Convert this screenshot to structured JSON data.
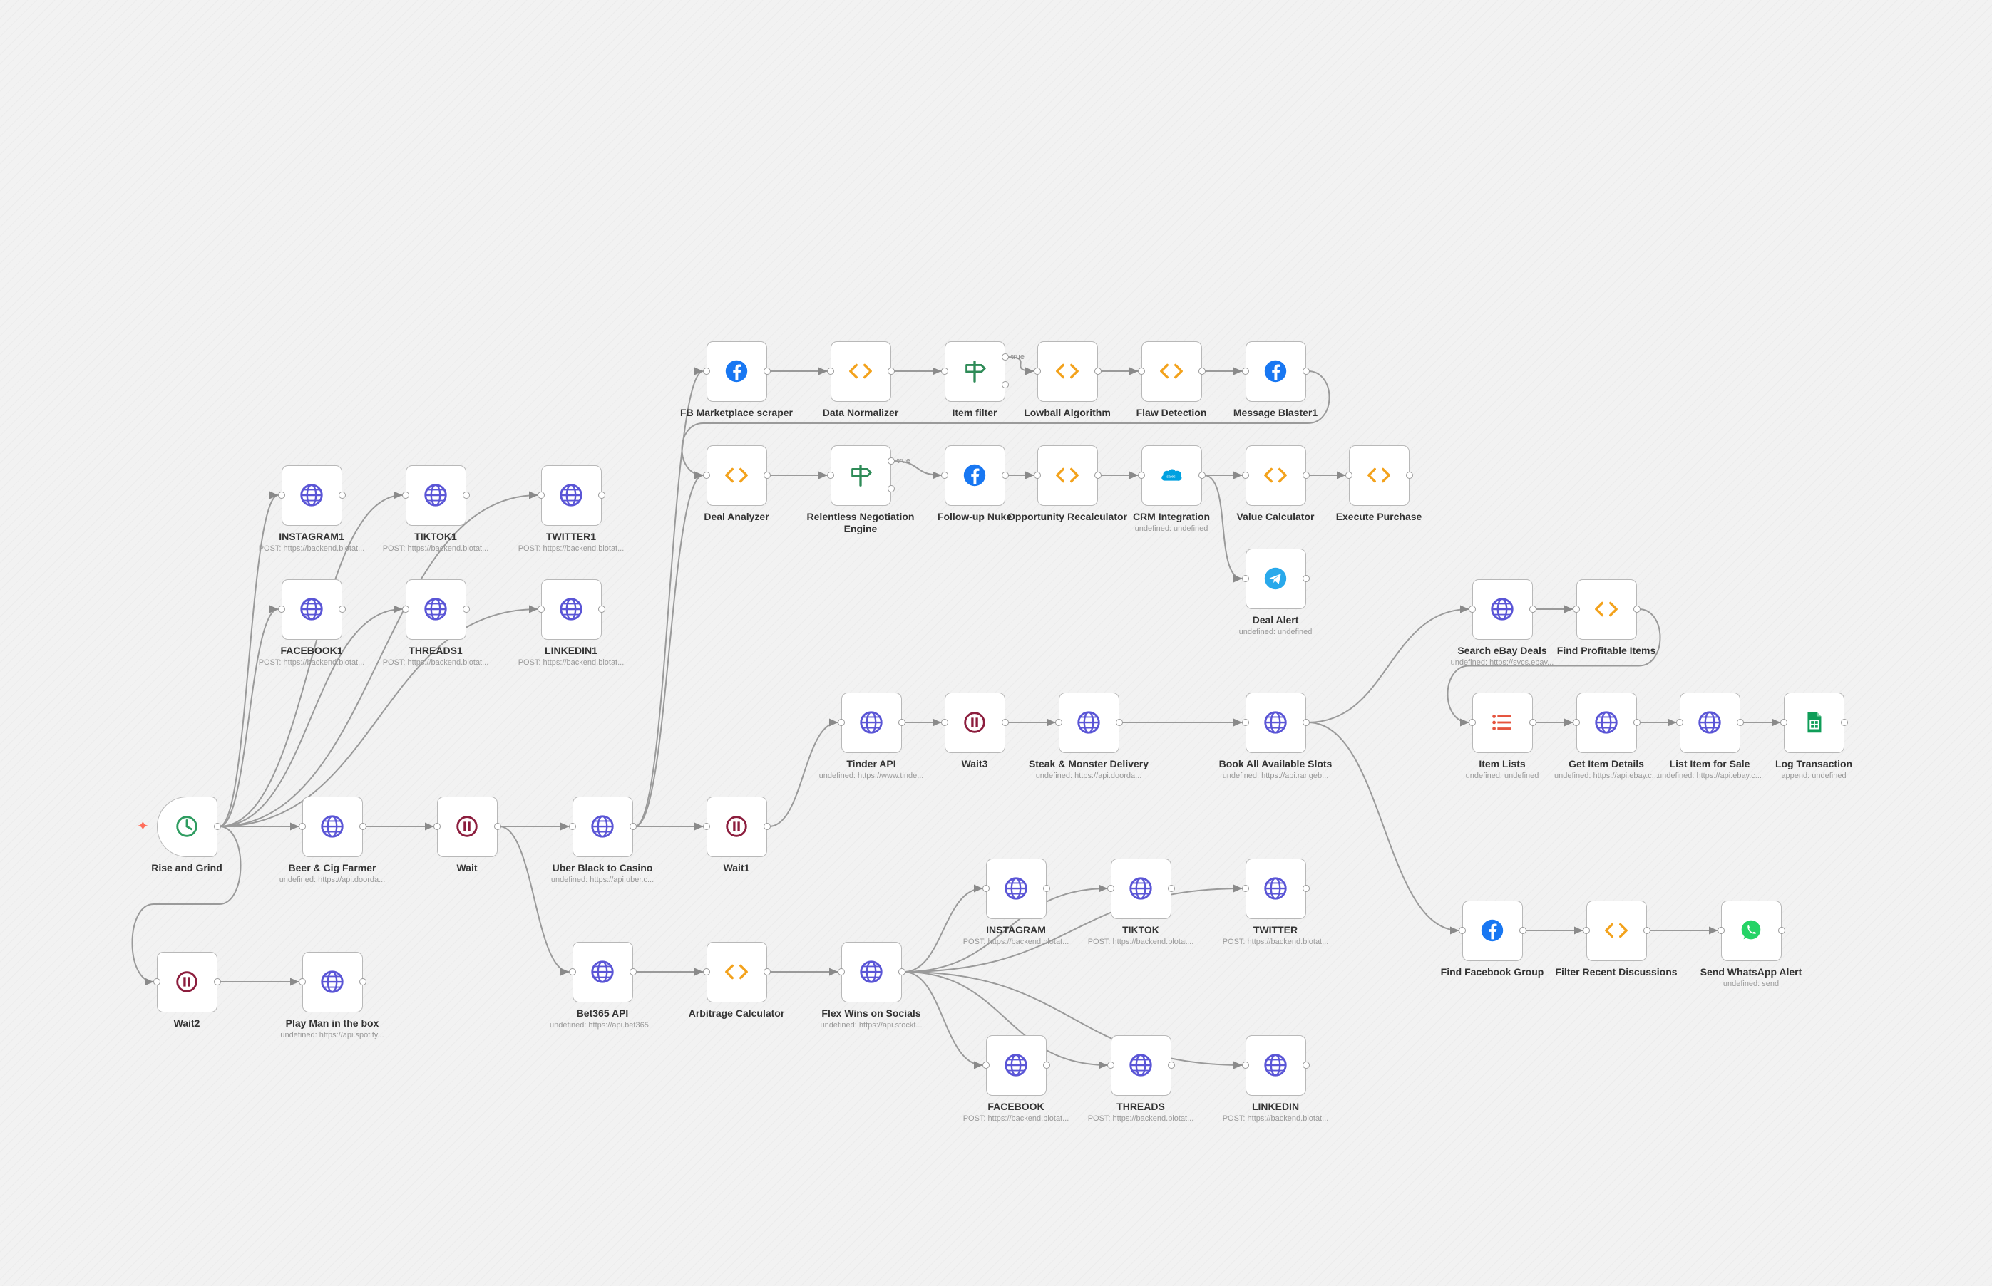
{
  "trigger_glyph": "✦",
  "colors": {
    "globe": "#5a55d6",
    "code": "#f3a21c",
    "wait": "#8c1d3d",
    "clock": "#2e9c60",
    "filter": "#2e8b57",
    "facebook": "#1877f2",
    "salesforce": "#00a1e0",
    "telegram": "#29a9eb",
    "whatsapp": "#25d366",
    "sheets": "#0f9d58",
    "list": "#e5533d",
    "edge": "#9a9a9a"
  },
  "branch_labels": {
    "item_filter": "true",
    "relentless": "true"
  },
  "nodes": [
    {
      "id": "rise",
      "label": "Rise and Grind",
      "sub": "",
      "icon": "clock-icon",
      "ports": "trigger"
    },
    {
      "id": "beer",
      "label": "Beer & Cig Farmer",
      "sub": "undefined: https://api.doorda...",
      "icon": "globe-icon",
      "ports": "io"
    },
    {
      "id": "wait",
      "label": "Wait",
      "sub": "",
      "icon": "pause-icon",
      "ports": "io"
    },
    {
      "id": "uber",
      "label": "Uber Black to Casino",
      "sub": "undefined: https://api.uber.c...",
      "icon": "globe-icon",
      "ports": "io"
    },
    {
      "id": "wait1",
      "label": "Wait1",
      "sub": "",
      "icon": "pause-icon",
      "ports": "io"
    },
    {
      "id": "wait2",
      "label": "Wait2",
      "sub": "",
      "icon": "pause-icon",
      "ports": "io"
    },
    {
      "id": "play",
      "label": "Play Man in the box",
      "sub": "undefined: https://api.spotify...",
      "icon": "globe-icon",
      "ports": "io"
    },
    {
      "id": "ig1",
      "label": "INSTAGRAM1",
      "sub": "POST: https://backend.blotat...",
      "icon": "globe-icon",
      "ports": "io"
    },
    {
      "id": "tt1",
      "label": "TIKTOK1",
      "sub": "POST: https://backend.blotat...",
      "icon": "globe-icon",
      "ports": "io"
    },
    {
      "id": "tw1",
      "label": "TWITTER1",
      "sub": "POST: https://backend.blotat...",
      "icon": "globe-icon",
      "ports": "io"
    },
    {
      "id": "fb1",
      "label": "FACEBOOK1",
      "sub": "POST: https://backend.blotat...",
      "icon": "globe-icon",
      "ports": "io"
    },
    {
      "id": "th1",
      "label": "THREADS1",
      "sub": "POST: https://backend.blotat...",
      "icon": "globe-icon",
      "ports": "io"
    },
    {
      "id": "li1",
      "label": "LINKEDIN1",
      "sub": "POST: https://backend.blotat...",
      "icon": "globe-icon",
      "ports": "io"
    },
    {
      "id": "fbm",
      "label": "FB Marketplace scraper",
      "sub": "",
      "icon": "facebook-icon",
      "ports": "io"
    },
    {
      "id": "dn",
      "label": "Data Normalizer",
      "sub": "",
      "icon": "code-icon",
      "ports": "io"
    },
    {
      "id": "if",
      "label": "Item filter",
      "sub": "",
      "icon": "filter-icon",
      "ports": "if"
    },
    {
      "id": "lowball",
      "label": "Lowball Algorithm",
      "sub": "",
      "icon": "code-icon",
      "ports": "io"
    },
    {
      "id": "flaw",
      "label": "Flaw Detection",
      "sub": "",
      "icon": "code-icon",
      "ports": "io"
    },
    {
      "id": "mb1",
      "label": "Message Blaster1",
      "sub": "",
      "icon": "facebook-icon",
      "ports": "io"
    },
    {
      "id": "da",
      "label": "Deal Analyzer",
      "sub": "",
      "icon": "code-icon",
      "ports": "io"
    },
    {
      "id": "rne",
      "label": "Relentless Negotiation Engine",
      "sub": "",
      "icon": "filter-icon",
      "ports": "if"
    },
    {
      "id": "fun",
      "label": "Follow-up Nuke",
      "sub": "",
      "icon": "facebook-icon",
      "ports": "io"
    },
    {
      "id": "opp",
      "label": "Opportunity Recalculator",
      "sub": "",
      "icon": "code-icon",
      "ports": "io"
    },
    {
      "id": "crm",
      "label": "CRM Integration",
      "sub": "undefined: undefined",
      "icon": "salesforce-icon",
      "ports": "io"
    },
    {
      "id": "vc",
      "label": "Value Calculator",
      "sub": "",
      "icon": "code-icon",
      "ports": "io"
    },
    {
      "id": "ep",
      "label": "Execute Purchase",
      "sub": "",
      "icon": "code-icon",
      "ports": "io"
    },
    {
      "id": "dal",
      "label": "Deal Alert",
      "sub": "undefined: undefined",
      "icon": "telegram-icon",
      "ports": "io"
    },
    {
      "id": "tinder",
      "label": "Tinder API",
      "sub": "undefined: https://www.tinde...",
      "icon": "globe-icon",
      "ports": "io"
    },
    {
      "id": "wait3",
      "label": "Wait3",
      "sub": "",
      "icon": "pause-icon",
      "ports": "io"
    },
    {
      "id": "steak",
      "label": "Steak & Monster Delivery",
      "sub": "undefined: https://api.doorda...",
      "icon": "globe-icon",
      "ports": "io"
    },
    {
      "id": "book",
      "label": "Book All Available Slots",
      "sub": "undefined: https://api.rangeb...",
      "icon": "globe-icon",
      "ports": "io"
    },
    {
      "id": "bet",
      "label": "Bet365 API",
      "sub": "undefined: https://api.bet365...",
      "icon": "globe-icon",
      "ports": "io"
    },
    {
      "id": "arb",
      "label": "Arbitrage Calculator",
      "sub": "",
      "icon": "code-icon",
      "ports": "io"
    },
    {
      "id": "flex",
      "label": "Flex Wins on Socials",
      "sub": "undefined: https://api.stockt...",
      "icon": "globe-icon",
      "ports": "io"
    },
    {
      "id": "ig",
      "label": "INSTAGRAM",
      "sub": "POST: https://backend.blotat...",
      "icon": "globe-icon",
      "ports": "io"
    },
    {
      "id": "tt",
      "label": "TIKTOK",
      "sub": "POST: https://backend.blotat...",
      "icon": "globe-icon",
      "ports": "io"
    },
    {
      "id": "tw",
      "label": "TWITTER",
      "sub": "POST: https://backend.blotat...",
      "icon": "globe-icon",
      "ports": "io"
    },
    {
      "id": "fb",
      "label": "FACEBOOK",
      "sub": "POST: https://backend.blotat...",
      "icon": "globe-icon",
      "ports": "io"
    },
    {
      "id": "th",
      "label": "THREADS",
      "sub": "POST: https://backend.blotat...",
      "icon": "globe-icon",
      "ports": "io"
    },
    {
      "id": "li",
      "label": "LINKEDIN",
      "sub": "POST: https://backend.blotat...",
      "icon": "globe-icon",
      "ports": "io"
    },
    {
      "id": "sed",
      "label": "Search eBay Deals",
      "sub": "undefined: https://svcs.ebay...",
      "icon": "globe-icon",
      "ports": "io"
    },
    {
      "id": "fpi",
      "label": "Find Profitable Items",
      "sub": "",
      "icon": "code-icon",
      "ports": "io"
    },
    {
      "id": "il",
      "label": "Item Lists",
      "sub": "undefined: undefined",
      "icon": "list-icon",
      "ports": "io"
    },
    {
      "id": "gid",
      "label": "Get Item Details",
      "sub": "undefined: https://api.ebay.c...",
      "icon": "globe-icon",
      "ports": "io"
    },
    {
      "id": "lis",
      "label": "List Item for Sale",
      "sub": "undefined: https://api.ebay.c...",
      "icon": "globe-icon",
      "ports": "io"
    },
    {
      "id": "log",
      "label": "Log Transaction",
      "sub": "append: undefined",
      "icon": "sheets-icon",
      "ports": "io"
    },
    {
      "id": "ffg",
      "label": "Find Facebook Group",
      "sub": "",
      "icon": "facebook-icon",
      "ports": "io"
    },
    {
      "id": "frd",
      "label": "Filter Recent Discussions",
      "sub": "",
      "icon": "code-icon",
      "ports": "io"
    },
    {
      "id": "swa",
      "label": "Send WhatsApp Alert",
      "sub": "undefined: send",
      "icon": "whatsapp-icon",
      "ports": "io"
    }
  ],
  "connections": [
    [
      "rise",
      "beer"
    ],
    [
      "rise",
      "ig1"
    ],
    [
      "rise",
      "tt1"
    ],
    [
      "rise",
      "tw1"
    ],
    [
      "rise",
      "fb1"
    ],
    [
      "rise",
      "th1"
    ],
    [
      "rise",
      "li1"
    ],
    [
      "rise",
      "wait2"
    ],
    [
      "beer",
      "wait"
    ],
    [
      "wait",
      "uber"
    ],
    [
      "wait",
      "bet"
    ],
    [
      "uber",
      "wait1"
    ],
    [
      "uber",
      "fbm"
    ],
    [
      "uber",
      "da"
    ],
    [
      "wait1",
      "tinder"
    ],
    [
      "wait2",
      "play"
    ],
    [
      "fbm",
      "dn"
    ],
    [
      "dn",
      "if"
    ],
    [
      "if",
      "lowball"
    ],
    [
      "lowball",
      "flaw"
    ],
    [
      "flaw",
      "mb1"
    ],
    [
      "mb1",
      "da"
    ],
    [
      "da",
      "rne"
    ],
    [
      "rne",
      "fun"
    ],
    [
      "fun",
      "opp"
    ],
    [
      "opp",
      "crm"
    ],
    [
      "crm",
      "vc"
    ],
    [
      "crm",
      "dal"
    ],
    [
      "vc",
      "ep"
    ],
    [
      "tinder",
      "wait3"
    ],
    [
      "wait3",
      "steak"
    ],
    [
      "steak",
      "book"
    ],
    [
      "book",
      "sed"
    ],
    [
      "book",
      "ffg"
    ],
    [
      "sed",
      "fpi"
    ],
    [
      "fpi",
      "il"
    ],
    [
      "il",
      "gid"
    ],
    [
      "gid",
      "lis"
    ],
    [
      "lis",
      "log"
    ],
    [
      "ffg",
      "frd"
    ],
    [
      "frd",
      "swa"
    ],
    [
      "bet",
      "arb"
    ],
    [
      "arb",
      "flex"
    ],
    [
      "flex",
      "ig"
    ],
    [
      "flex",
      "tt"
    ],
    [
      "flex",
      "tw"
    ],
    [
      "flex",
      "fb"
    ],
    [
      "flex",
      "th"
    ],
    [
      "flex",
      "li"
    ]
  ]
}
